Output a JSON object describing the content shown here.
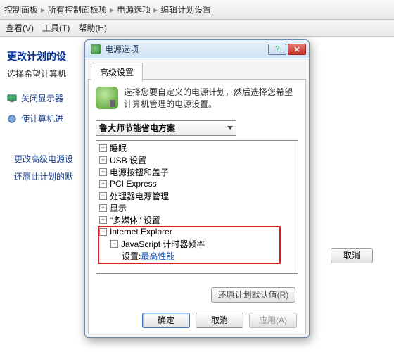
{
  "breadcrumb": {
    "a": "控制面板",
    "b": "所有控制面板项",
    "c": "电源选项",
    "d": "编辑计划设置"
  },
  "menu": {
    "view": "查看(V)",
    "tools": "工具(T)",
    "help": "帮助(H)"
  },
  "left": {
    "heading": "更改计划的设",
    "sub": "选择希望计算机",
    "link1": "关闭显示器",
    "link2": "使计算机进"
  },
  "blue_links": {
    "a": "更改高级电源设",
    "b": "还原此计划的默"
  },
  "bg_cancel": "取消",
  "dialog": {
    "title": "电源选项",
    "tab": "高级设置",
    "desc": "选择您要自定义的电源计划，然后选择您希望计算机管理的电源设置。",
    "plan": "鲁大师节能省电方案",
    "tree": {
      "n1": "睡眠",
      "n2": "USB 设置",
      "n3": "电源按钮和盖子",
      "n4": "PCI Express",
      "n5": "处理器电源管理",
      "n6": "显示",
      "n7": "\"多媒体\" 设置",
      "ie": "Internet Explorer",
      "js": "JavaScript 计时器频率",
      "setting_label": "设置: ",
      "setting_value": "最高性能"
    },
    "restore": "还原计划默认值(R)",
    "ok": "确定",
    "cancel": "取消",
    "apply": "应用(A)"
  }
}
